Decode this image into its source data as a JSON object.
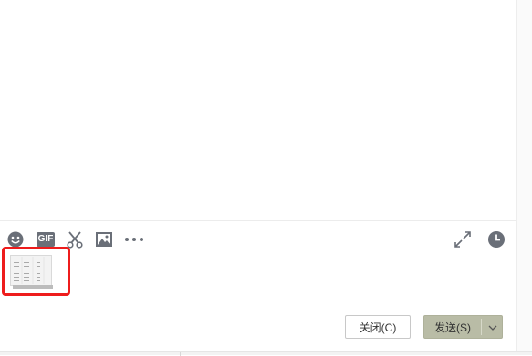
{
  "footer": {
    "close_label": "关闭(C)",
    "send_label": "发送(S)"
  },
  "toolbar": {
    "gif_label": "GIF",
    "icons": [
      "emoji-icon",
      "gif-icon",
      "scissors-icon",
      "image-icon",
      "more-icon",
      "expand-icon",
      "clock-icon"
    ]
  },
  "attachment": {
    "highlight_color": "#ee1c1c"
  },
  "colors": {
    "send_button": "#b9bca6",
    "icon": "#6a6f78"
  }
}
